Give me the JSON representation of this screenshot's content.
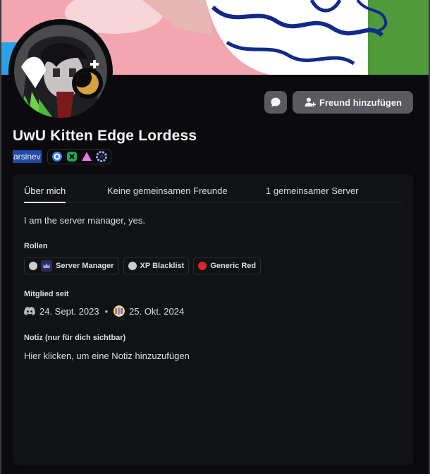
{
  "profile": {
    "display_name": "UwU Kitten Edge Lordess",
    "username": "arsinev",
    "badges": [
      "nitro-icon",
      "xbox-icon",
      "hypesquad-icon",
      "boost-icon"
    ],
    "status": "idle"
  },
  "actions": {
    "message_icon": "chat-bubble-icon",
    "add_friend_label": "Freund hinzufügen"
  },
  "tabs": [
    {
      "label": "Über mich",
      "active": true
    },
    {
      "label": "Keine gemeinsamen Freunde",
      "active": false
    },
    {
      "label": "1 gemeinsamer Server",
      "active": false
    }
  ],
  "about": {
    "bio": "I am the server manager, yes.",
    "roles_title": "Rollen",
    "roles": [
      {
        "label": "Server Manager",
        "color": "#c9ccd1",
        "icon": "crown-icon"
      },
      {
        "label": "XP Blacklist",
        "color": "#c9ccd1"
      },
      {
        "label": "Generic Red",
        "color": "#e0242b"
      }
    ],
    "member_since_title": "Mitglied seit",
    "discord_join_date": "24. Sept. 2023",
    "server_join_date": "25. Okt. 2024",
    "note_title": "Notiz (nur für dich sichtbar)",
    "note_placeholder": "Hier klicken, um eine Notiz hinzuzufügen"
  },
  "colors": {
    "background": "#0b0b0d",
    "card": "#111214",
    "button": "#5a5a60",
    "username_highlight": "#1e4aa8",
    "idle_status": "#d7a040"
  }
}
